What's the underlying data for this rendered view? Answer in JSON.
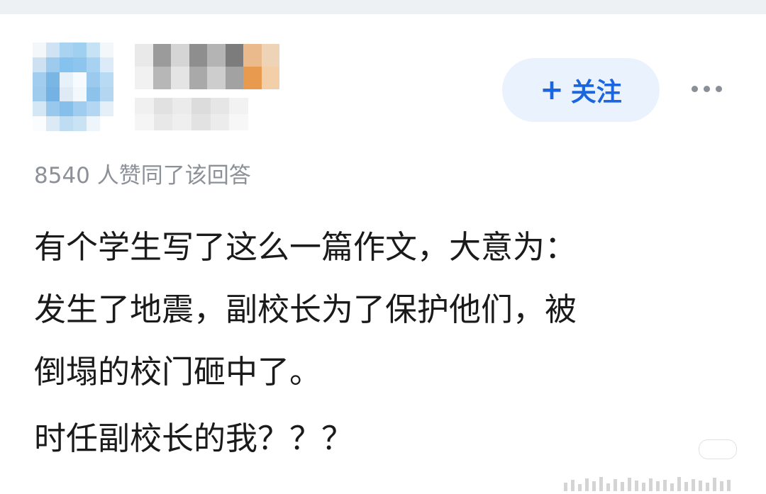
{
  "header": {
    "follow_label": "关注",
    "follow_icon": "plus-icon",
    "more_icon": "more-dots-icon"
  },
  "answer": {
    "vote_text": "8540 人赞同了该回答",
    "paragraphs": [
      "有个学生写了这么一篇作文，大意为：",
      "发生了地震，副校长为了保护他们，被",
      "倒塌的校门砸中了。",
      "时任副校长的我？？？"
    ]
  },
  "colors": {
    "accent": "#1a66e0",
    "follow_bg": "#eaf2fe",
    "muted_text": "#8c9097",
    "body_text": "#1a1a1a"
  }
}
